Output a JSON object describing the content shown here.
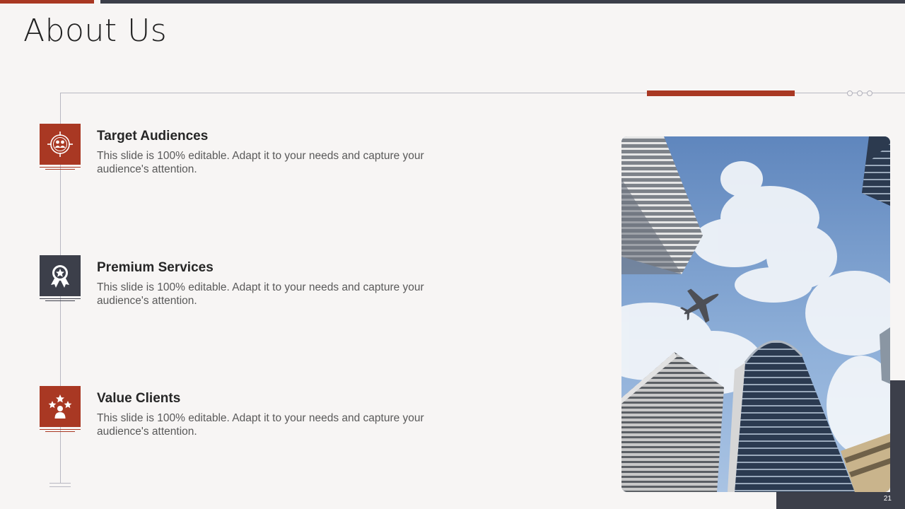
{
  "slide": {
    "title": "About Us",
    "page_number": "21"
  },
  "items": [
    {
      "title": "Target Audiences",
      "description": "This slide is 100% editable. Adapt it to your needs and capture your audience's attention.",
      "icon": "target-audience-icon",
      "color": "#a93823"
    },
    {
      "title": "Premium Services",
      "description": "This slide is 100% editable. Adapt it to your needs and capture your audience's attention.",
      "icon": "award-ribbon-icon",
      "color": "#3c3f4a"
    },
    {
      "title": "Value Clients",
      "description": "This slide is 100% editable. Adapt it to your needs and capture your audience's attention.",
      "icon": "star-client-icon",
      "color": "#a93823"
    }
  ],
  "colors": {
    "accent": "#a93823",
    "dark": "#3c3f4a",
    "background": "#f7f5f4"
  },
  "image": {
    "subject": "skyscrapers-and-airplane-photo"
  }
}
